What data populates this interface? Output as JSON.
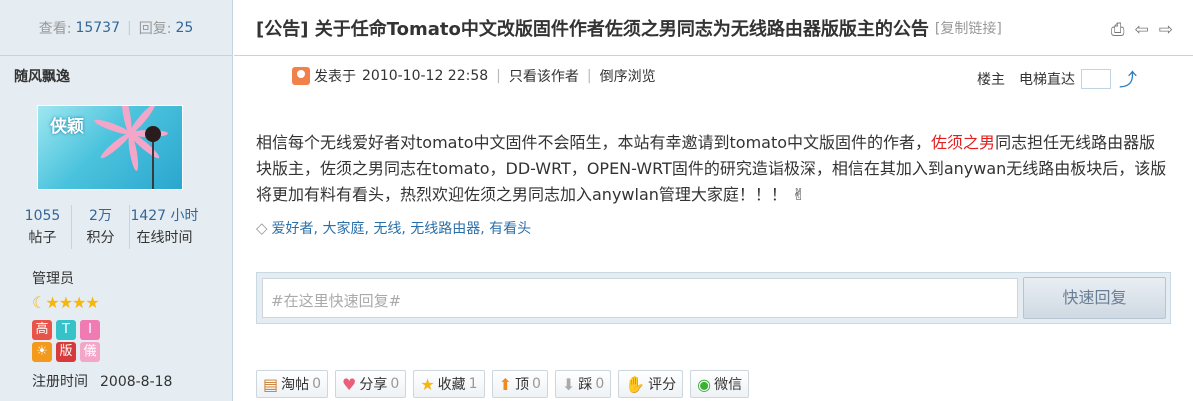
{
  "sidebar": {
    "views_label": "查看:",
    "views_value": "15737",
    "replies_label": "回复:",
    "replies_value": "25",
    "author_name": "随风飘逸",
    "avatar_text": "侠颖",
    "stats": [
      {
        "value": "1055",
        "label": "帖子"
      },
      {
        "value": "2万",
        "label": "积分"
      },
      {
        "value": "1427 小时",
        "label": "在线时间"
      }
    ],
    "group": "管理员",
    "reg_label": "注册时间",
    "reg_value": "2008-8-18"
  },
  "post": {
    "title_tag": "[公告]",
    "title_text": "关于任命Tomato中文改版固件作者佐须之男同志为无线路由器版版主的公告",
    "copy_link": "[复制链接]",
    "posted_label": "发表于",
    "posted_time": "2010-10-12 22:58",
    "only_author": "只看该作者",
    "reverse": "倒序浏览",
    "floor_label": "楼主",
    "jump_label": "电梯直达",
    "content_before": "相信每个无线爱好者对tomato中文固件不会陌生，本站有幸邀请到tomato中文版固件的作者，",
    "content_highlight": "佐须之男",
    "content_after": "同志担任无线路由器版块版主，佐须之男同志在tomato，DD-WRT，OPEN-WRT固件的研究造诣极深，相信在其加入到anywan无线路由板块后，该版将更加有料有看头，热烈欢迎佐须之男同志加入anywlan管理大家庭！！！",
    "tags": "爱好者, 大家庭, 无线, 无线路由器, 有看头"
  },
  "reply": {
    "placeholder": "#在这里快速回复#",
    "button": "快速回复"
  },
  "actions": [
    {
      "icon": "reply-icon",
      "label": "淘帖",
      "count": "0"
    },
    {
      "icon": "share-icon",
      "label": "分享",
      "count": "0"
    },
    {
      "icon": "star-icon",
      "label": "收藏",
      "count": "1"
    },
    {
      "icon": "thumbs-up-icon",
      "label": "顶",
      "count": "0"
    },
    {
      "icon": "thumbs-down-icon",
      "label": "踩",
      "count": "0"
    },
    {
      "icon": "rate-icon",
      "label": "评分",
      "count": ""
    },
    {
      "icon": "wechat-icon",
      "label": "微信",
      "count": ""
    }
  ],
  "colors": {
    "accent": "#336699",
    "highlight": "#e02020",
    "sidebar_bg": "#e5edf2"
  }
}
